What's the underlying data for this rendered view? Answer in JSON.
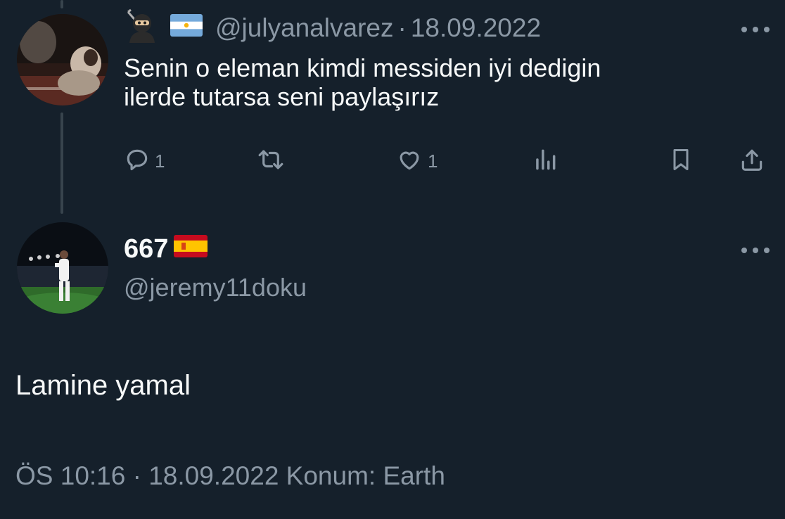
{
  "reply": {
    "handle": "@julyanalvarez",
    "separator": "·",
    "date": "18.09.2022",
    "text_line1": "Senin o eleman kimdi messiden iyi dedigin",
    "text_line2": "ilerde tutarsa seni paylaşırız",
    "actions": {
      "reply_count": "1",
      "like_count": "1"
    },
    "icons": [
      "ninja-emoji-icon",
      "argentina-flag-icon",
      "more-icon",
      "reply-icon",
      "retweet-icon",
      "like-icon",
      "views-icon",
      "bookmark-icon",
      "share-icon"
    ]
  },
  "main": {
    "display_name": "667",
    "handle": "@jeremy11doku",
    "text": "Lamine yamal",
    "meta": "ÖS 10:16 · 18.09.2022 Konum: Earth",
    "icons": [
      "spain-flag-icon",
      "more-icon"
    ]
  },
  "colors": {
    "background": "#15202b",
    "text": "#f7f9f9",
    "muted": "#8b98a5",
    "thread_line": "#38444d"
  }
}
